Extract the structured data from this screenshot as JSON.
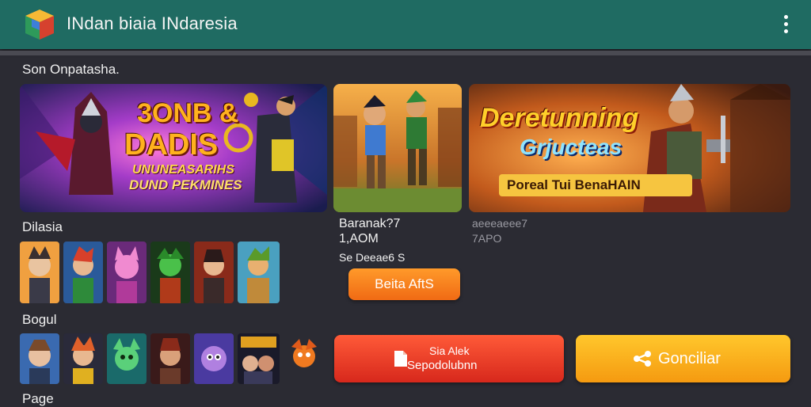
{
  "app": {
    "title": "INdan biaia INdaresia",
    "logo_icon": "app-box-logo",
    "menu_icon": "kebab-menu-icon"
  },
  "colors": {
    "appbar": "#1f6b62",
    "background": "#2b2b33",
    "orange_button": "#f06a14",
    "red_button": "#d7281c",
    "yellow_button": "#f59a10"
  },
  "sections": {
    "top_title": "Son Onpatasha.",
    "row1_title": "Dilasia",
    "row2_title": "Bogul",
    "row3_title": "Page"
  },
  "banners": {
    "first": {
      "title1": "3ONB &",
      "title2": "DADIS",
      "sub1": "UNUNEASARIHS",
      "sub2": "DUND PEKMINES"
    },
    "third": {
      "title1": "Deretunning",
      "title2": "Grjucteas",
      "sub": "Poreal Tui BenaHAIN"
    }
  },
  "detail": {
    "name": "Baranak?7",
    "time": "1,AOM",
    "size": "Se Deeae6 S",
    "alt_name": "aeeeaeee7",
    "alt_time": "7APO",
    "beta_button": "Beita AftS"
  },
  "actions": {
    "download_line1": "Sia Alek",
    "download_line2": "Sepodolubnn",
    "download_icon": "file-icon",
    "go_label": "Gonciliar",
    "go_icon": "share-icon"
  }
}
